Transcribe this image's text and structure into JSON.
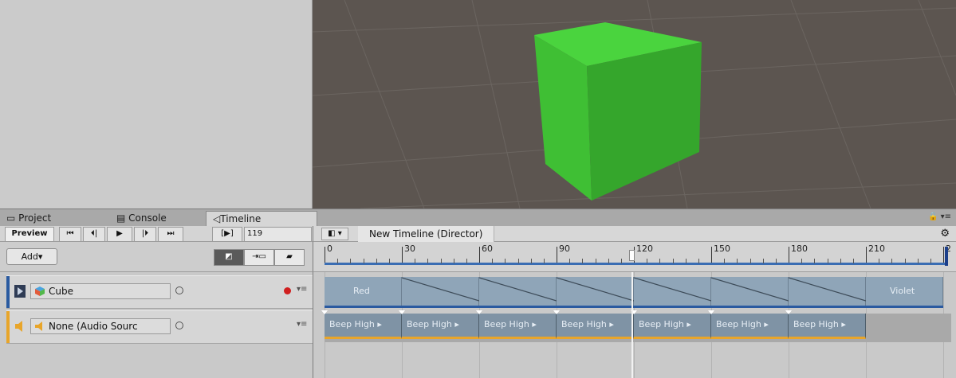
{
  "tabs": [
    {
      "label": "Project",
      "icon": "folder-icon"
    },
    {
      "label": "Console",
      "icon": "console-icon"
    },
    {
      "label": "Timeline",
      "icon": "timeline-icon",
      "active": true
    }
  ],
  "transport": {
    "preview_label": "Preview",
    "buttons": [
      "⏮",
      "⏴|",
      "▶",
      "|⏵",
      "⏭"
    ],
    "frame_bracket": "[▶]",
    "current_frame": "119"
  },
  "timeline_header": {
    "title": "New Timeline (Director)",
    "settings_icon": "gear-icon"
  },
  "toolbar": {
    "add_label": "Add▾"
  },
  "ruler": {
    "labels": [
      "0",
      "30",
      "60",
      "90",
      "120",
      "150",
      "180",
      "210",
      "2"
    ],
    "playhead_frame": 119
  },
  "tracks": [
    {
      "name": "Cube",
      "type": "animation",
      "color": "#2a5aa0",
      "record": true
    },
    {
      "name": "None (Audio Sourc",
      "type": "audio",
      "color": "#e8a52a",
      "record": false
    }
  ],
  "animation_clips": [
    {
      "label": "Red",
      "start": 0,
      "end": 30
    },
    {
      "label": "",
      "start": 30,
      "end": 60
    },
    {
      "label": "",
      "start": 60,
      "end": 90
    },
    {
      "label": "",
      "start": 90,
      "end": 120
    },
    {
      "label": "",
      "start": 120,
      "end": 150
    },
    {
      "label": "",
      "start": 150,
      "end": 180
    },
    {
      "label": "",
      "start": 180,
      "end": 210
    },
    {
      "label": "Violet",
      "start": 210,
      "end": 240
    }
  ],
  "audio_clips": [
    {
      "label": "Beep High",
      "start": 0,
      "end": 30
    },
    {
      "label": "Beep High",
      "start": 30,
      "end": 60
    },
    {
      "label": "Beep High",
      "start": 60,
      "end": 90
    },
    {
      "label": "Beep High",
      "start": 90,
      "end": 120
    },
    {
      "label": "Beep High",
      "start": 120,
      "end": 150
    },
    {
      "label": "Beep High",
      "start": 150,
      "end": 180
    },
    {
      "label": "Beep High",
      "start": 180,
      "end": 210
    }
  ],
  "colors": {
    "cube_green": "#45c43a",
    "clip_blue": "#8fa5b8",
    "audio_orange": "#e8a52a",
    "scene_bg": "#5c5550"
  }
}
